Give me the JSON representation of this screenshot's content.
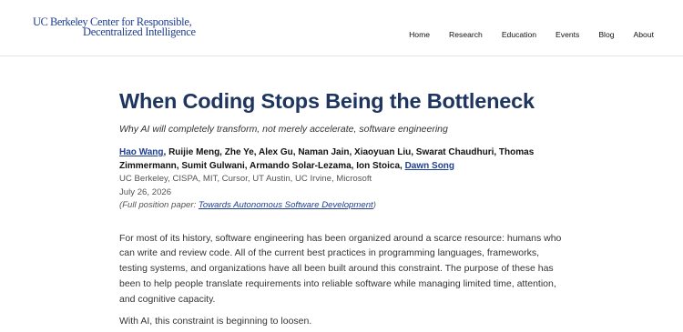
{
  "header": {
    "logo_line1_prefix": "UC Berkeley",
    "logo_line1_rest": "Center for Responsible,",
    "logo_line2": "Decentralized Intelligence",
    "nav": [
      "Home",
      "Research",
      "Education",
      "Events",
      "Blog",
      "About"
    ]
  },
  "article": {
    "title": "When Coding Stops Being the Bottleneck",
    "subtitle": "Why AI will completely transform, not merely accelerate, software engineering",
    "authors_lead_link": "Hao Wang",
    "authors_middle": ", Ruijie Meng, Zhe Ye, Alex Gu, Naman Jain, Xiaoyuan Liu, Swarat Chaudhuri, Thomas Zimmermann, Sumit Gulwani, Armando Solar-Lezama, Ion Stoica, ",
    "authors_last_link": "Dawn Song",
    "affiliations": "UC Berkeley, CISPA, MIT, Cursor, UT Austin, UC Irvine, Microsoft",
    "date": "July 26, 2026",
    "position_prefix": "(Full position paper: ",
    "position_link": "Towards Autonomous Software Development",
    "position_suffix": ")",
    "paragraph1": "For most of its history, software engineering has been organized around a scarce resource: humans who can write and review code. All of the current best practices in programming languages, frameworks, testing systems, and organizations have all been built around this constraint. The purpose of these has been to help people translate requirements into reliable software while managing limited time, attention, and cognitive capacity.",
    "paragraph2": "With AI, this constraint is beginning to loosen."
  }
}
